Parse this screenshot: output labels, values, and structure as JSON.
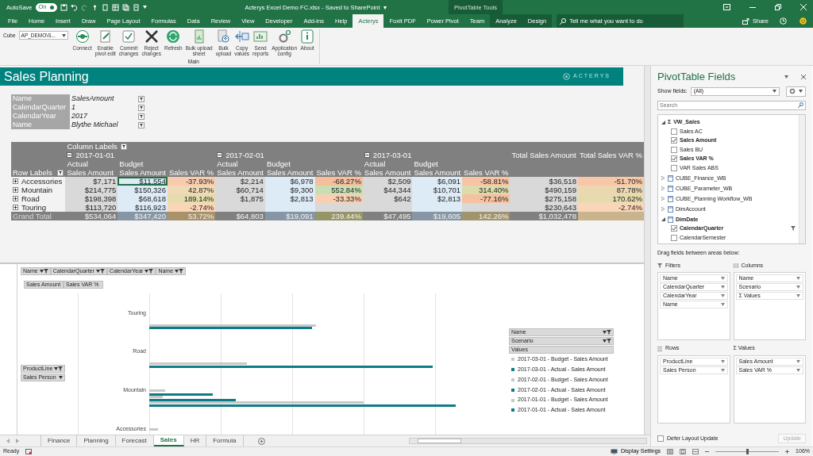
{
  "titlebar": {
    "autosave_label": "AutoSave",
    "autosave_toggle": {
      "label": "On",
      "on": true
    },
    "title": "Acterys Excel Demo FC.xlsx  -  Saved to SharePoint",
    "title_caret": "▾",
    "context_label": "PivotTable Tools"
  },
  "ribbon_tabs": [
    {
      "label": "File",
      "selected": false,
      "context": false
    },
    {
      "label": "Home",
      "selected": false,
      "context": false
    },
    {
      "label": "Insert",
      "selected": false,
      "context": false
    },
    {
      "label": "Draw",
      "selected": false,
      "context": false
    },
    {
      "label": "Page Layout",
      "selected": false,
      "context": false
    },
    {
      "label": "Formulas",
      "selected": false,
      "context": false
    },
    {
      "label": "Data",
      "selected": false,
      "context": false
    },
    {
      "label": "Review",
      "selected": false,
      "context": false
    },
    {
      "label": "View",
      "selected": false,
      "context": false
    },
    {
      "label": "Developer",
      "selected": false,
      "context": false
    },
    {
      "label": "Add-ins",
      "selected": false,
      "context": false
    },
    {
      "label": "Help",
      "selected": false,
      "context": false
    },
    {
      "label": "Acterys",
      "selected": true,
      "context": false
    },
    {
      "label": "Foxit PDF",
      "selected": false,
      "context": false
    },
    {
      "label": "Power Pivot",
      "selected": false,
      "context": false
    },
    {
      "label": "Team",
      "selected": false,
      "context": false
    },
    {
      "label": "Analyze",
      "selected": false,
      "context": true
    },
    {
      "label": "Design",
      "selected": false,
      "context": true
    }
  ],
  "tell_me": {
    "placeholder": "Tell me what you want to do"
  },
  "share": "Share",
  "ribbon": {
    "cube_label": "Cube",
    "cube_value": "AP_DEMO\\S...",
    "group_label": "Main",
    "buttons": [
      {
        "label": "Connect",
        "kind": "connect"
      },
      {
        "label": "Enable\npivot edit",
        "kind": "edit"
      },
      {
        "label": "Commit\nchanges",
        "kind": "commit"
      },
      {
        "label": "Reject\nchanges",
        "kind": "reject"
      },
      {
        "label": "Refresh",
        "kind": "refresh"
      },
      {
        "label": "Bulk upload\nsheet",
        "kind": "sheet"
      },
      {
        "label": "Bulk\nupload",
        "kind": "upload"
      },
      {
        "label": "Copy\nvalues",
        "kind": "copy"
      },
      {
        "label": "Send\nreports",
        "kind": "send"
      },
      {
        "label": "Application\nconfig",
        "kind": "config"
      },
      {
        "label": "About",
        "kind": "about"
      }
    ]
  },
  "banner": {
    "title": "Sales Planning",
    "logo": "ACTERYS"
  },
  "page_filters": [
    {
      "field": "Name",
      "value": "SalesAmount"
    },
    {
      "field": "CalendarQuarter",
      "value": "1"
    },
    {
      "field": "CalendarYear",
      "value": "2017"
    },
    {
      "field": "Name",
      "value": "Blythe Michael"
    }
  ],
  "pivot": {
    "column_labels": "Column Labels",
    "row_labels": "Row Labels",
    "periods": [
      {
        "label": "2017-01-01",
        "expanded": true,
        "subheaders": [
          {
            "scenario": "Actual",
            "measure": "Sales Amount"
          },
          {
            "scenario": "Budget",
            "measure": "Sales Amount"
          },
          {
            "measure": "Sales VAR %"
          }
        ]
      },
      {
        "label": "2017-02-01",
        "expanded": true,
        "subheaders": [
          {
            "scenario": "Actual",
            "measure": "Sales Amount"
          },
          {
            "scenario": "Budget",
            "measure": "Sales Amount"
          },
          {
            "measure": "Sales VAR %"
          }
        ]
      },
      {
        "label": "2017-03-01",
        "expanded": true,
        "subheaders": [
          {
            "scenario": "Actual",
            "measure": "Sales Amount"
          },
          {
            "scenario": "Budget",
            "measure": "Sales Amount"
          },
          {
            "measure": "Sales VAR %"
          }
        ]
      }
    ],
    "totals": [
      "Total Sales Amount",
      "Total Sales VAR %"
    ],
    "rows": [
      {
        "label": "Accessories",
        "kind": "item",
        "expanded": false,
        "cells": [
          {
            "text": "$7,171",
            "color": "#d9d9d9",
            "selected": false
          },
          {
            "text": "$11,554",
            "color": "#ddebf7",
            "selected": true
          },
          {
            "text": "-37.93%",
            "color": "#f8cbad",
            "selected": false
          },
          {
            "text": "$2,214",
            "color": "#d9d9d9",
            "selected": false
          },
          {
            "text": "$6,978",
            "color": "#ddebf7",
            "selected": false
          },
          {
            "text": "-68.27%",
            "color": "#f6bf9c",
            "selected": false
          },
          {
            "text": "$2,509",
            "color": "#d9d9d9",
            "selected": false
          },
          {
            "text": "$6,091",
            "color": "#ddebf7",
            "selected": false
          },
          {
            "text": "-58.81%",
            "color": "#f7c4a4",
            "selected": false
          },
          {
            "text": "$36,518",
            "color": "#d9d9d9",
            "selected": false
          },
          {
            "text": "-51.70%",
            "color": "#f8c7a8",
            "selected": false
          }
        ]
      },
      {
        "label": "Mountain",
        "kind": "item",
        "expanded": false,
        "cells": [
          {
            "text": "$214,775",
            "color": "#d9d9d9",
            "selected": false
          },
          {
            "text": "$150,326",
            "color": "#ddebf7",
            "selected": false
          },
          {
            "text": "42.87%",
            "color": "#f0d9b5",
            "selected": false
          },
          {
            "text": "$60,714",
            "color": "#d9d9d9",
            "selected": false
          },
          {
            "text": "$9,300",
            "color": "#ddebf7",
            "selected": false
          },
          {
            "text": "552.84%",
            "color": "#c6e0b4",
            "selected": false
          },
          {
            "text": "$44,344",
            "color": "#d9d9d9",
            "selected": false
          },
          {
            "text": "$10,701",
            "color": "#ddebf7",
            "selected": false
          },
          {
            "text": "314.40%",
            "color": "#dadcaa",
            "selected": false
          },
          {
            "text": "$490,159",
            "color": "#d9d9d9",
            "selected": false
          },
          {
            "text": "87.78%",
            "color": "#ecd8b0",
            "selected": false
          }
        ]
      },
      {
        "label": "Road",
        "kind": "item",
        "expanded": false,
        "cells": [
          {
            "text": "$198,398",
            "color": "#d9d9d9",
            "selected": false
          },
          {
            "text": "$68,618",
            "color": "#ddebf7",
            "selected": false
          },
          {
            "text": "189.14%",
            "color": "#e4dcac",
            "selected": false
          },
          {
            "text": "$1,875",
            "color": "#d9d9d9",
            "selected": false
          },
          {
            "text": "$2,813",
            "color": "#ddebf7",
            "selected": false
          },
          {
            "text": "-33.33%",
            "color": "#f8cfb0",
            "selected": false
          },
          {
            "text": "$642",
            "color": "#d9d9d9",
            "selected": false
          },
          {
            "text": "$2,813",
            "color": "#ddebf7",
            "selected": false
          },
          {
            "text": "-77.16%",
            "color": "#f6c1a0",
            "selected": false
          },
          {
            "text": "$275,158",
            "color": "#d9d9d9",
            "selected": false
          },
          {
            "text": "170.62%",
            "color": "#e6dbae",
            "selected": false
          }
        ]
      },
      {
        "label": "Touring",
        "kind": "item",
        "expanded": false,
        "cells": [
          {
            "text": "$113,720",
            "color": "#d9d9d9",
            "selected": false
          },
          {
            "text": "$116,923",
            "color": "#ddebf7",
            "selected": false
          },
          {
            "text": "-2.74%",
            "color": "#fbd5b8",
            "selected": false
          },
          {
            "color": "#d9d9d9",
            "selected": false
          },
          {
            "color": "#ddebf7",
            "selected": false
          },
          {
            "color": "#d9d9d9",
            "selected": false
          },
          {
            "color": "#d9d9d9",
            "selected": false
          },
          {
            "color": "#ddebf7",
            "selected": false
          },
          {
            "color": "#d9d9d9",
            "selected": false
          },
          {
            "text": "$230,643",
            "color": "#d9d9d9",
            "selected": false
          },
          {
            "text": "-2.74%",
            "color": "#fbd5b8",
            "selected": false
          }
        ]
      },
      {
        "label": "Grand Total",
        "kind": "total",
        "cells": [
          {
            "text": "$534,064",
            "color": "#808080",
            "selected": false
          },
          {
            "text": "$347,420",
            "color": "#8796a4",
            "selected": false
          },
          {
            "text": "53.72%",
            "color": "#a8926a",
            "selected": false
          },
          {
            "text": "$64,803",
            "color": "#808080",
            "selected": false
          },
          {
            "text": "$19,091",
            "color": "#8796a4",
            "selected": false
          },
          {
            "text": "239.44%",
            "color": "#959568",
            "selected": false
          },
          {
            "text": "$47,495",
            "color": "#808080",
            "selected": false
          },
          {
            "text": "$19,605",
            "color": "#8796a4",
            "selected": false
          },
          {
            "text": "142.26%",
            "color": "#a0946c",
            "selected": false
          },
          {
            "text": "$1,032,478",
            "color": "#808080",
            "selected": false
          },
          {
            "color": "#c9b48e",
            "selected": false
          }
        ]
      }
    ]
  },
  "pivot_chart": {
    "filter_buttons": [
      {
        "label": "Name",
        "kind": "filter"
      },
      {
        "label": "CalendarQuarter",
        "kind": "filter"
      },
      {
        "label": "CalendarYear",
        "kind": "filter"
      },
      {
        "label": "Name",
        "kind": "filter"
      }
    ],
    "value_buttons": [
      {
        "label": "Sales Amount"
      },
      {
        "label": "Sales VAR %"
      }
    ],
    "axis_buttons": [
      {
        "label": "ProductLine",
        "kind": "filter"
      },
      {
        "label": "Sales Person",
        "kind": "dropdown"
      }
    ],
    "categories": [
      "Touring",
      "Road",
      "Mountain",
      "Accessories"
    ],
    "legend_buttons": [
      {
        "label": "Name",
        "kind": "filter"
      },
      {
        "label": "Scenario",
        "kind": "filter"
      },
      {
        "label": "Values",
        "kind": "plain"
      }
    ],
    "legend": [
      {
        "label": "2017-03-01 - Budget - Sales Amount",
        "color": "#c8c8c8"
      },
      {
        "label": "2017-03-01 - Actual - Sales Amount",
        "color": "#0e7c86"
      },
      {
        "label": "2017-02-01 - Budget - Sales Amount",
        "color": "#c8c8c8"
      },
      {
        "label": "2017-02-01 - Actual - Sales Amount",
        "color": "#0e7c86"
      },
      {
        "label": "2017-01-01 - Budget - Sales Amount",
        "color": "#c8c8c8"
      },
      {
        "label": "2017-01-01 - Actual - Sales Amount",
        "color": "#0e7c86"
      }
    ]
  },
  "sheet_tabs": [
    {
      "label": "Finance",
      "selected": false
    },
    {
      "label": "Planning",
      "selected": false
    },
    {
      "label": "Forecast",
      "selected": false
    },
    {
      "label": "Sales",
      "selected": true
    },
    {
      "label": "HR",
      "selected": false
    },
    {
      "label": "Formula",
      "selected": false
    }
  ],
  "field_list": {
    "title": "PivotTable Fields",
    "show_fields_label": "Show fields:",
    "show_fields_value": "(All)",
    "search_placeholder": "Search",
    "tables": [
      {
        "name": "VW_Sales",
        "kind": "measures",
        "symbol": "Σ",
        "expanded": true,
        "children": [
          {
            "name": "Sales AC",
            "checked": false,
            "filtered": false
          },
          {
            "name": "Sales Amount",
            "checked": true,
            "filtered": false
          },
          {
            "name": "Sales BU",
            "checked": false,
            "filtered": false
          },
          {
            "name": "Sales VAR %",
            "checked": true,
            "filtered": false
          },
          {
            "name": "VAR Sales ABS",
            "checked": false,
            "filtered": false
          }
        ]
      },
      {
        "name": "CUBE_Finance_WB",
        "kind": "table",
        "expanded": false
      },
      {
        "name": "CUBE_Parameter_WB",
        "kind": "table",
        "expanded": false
      },
      {
        "name": "CUBE_Planning Workflow_WB",
        "kind": "table",
        "expanded": false
      },
      {
        "name": "DimAccount",
        "kind": "table",
        "expanded": false
      },
      {
        "name": "DimDate",
        "kind": "table",
        "expanded": true,
        "children": [
          {
            "name": "CalendarQuarter",
            "checked": true,
            "filtered": true
          },
          {
            "name": "CalendarSemester",
            "checked": false,
            "filtered": false
          }
        ]
      }
    ],
    "drag_hint": "Drag fields between areas below:",
    "areas": [
      {
        "title": "Filters",
        "kind": "filters",
        "items": [
          "Name",
          "CalendarQuarter",
          "CalendarYear",
          "Name"
        ]
      },
      {
        "title": "Columns",
        "kind": "columns",
        "items": [
          "Name",
          "Scenario",
          "Σ  Values"
        ]
      },
      {
        "title": "Rows",
        "kind": "rows",
        "items": [
          "ProductLine",
          "Sales Person"
        ]
      },
      {
        "title": "Σ  Values",
        "kind": "values",
        "items": [
          "Sales Amount",
          "Sales VAR %"
        ]
      }
    ],
    "defer": {
      "label": "Defer Layout Update",
      "checked": false
    },
    "update_button": {
      "label": "Update",
      "disabled": true
    }
  },
  "status": {
    "ready": "Ready",
    "display_settings": "Display Settings",
    "zoom": "106%",
    "zoom_slider": {
      "level": 0.5
    }
  }
}
